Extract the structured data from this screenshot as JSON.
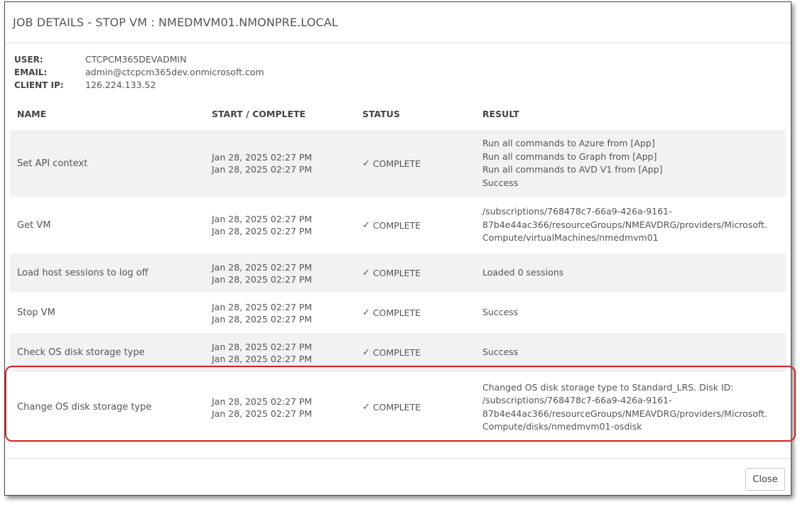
{
  "dialog": {
    "title": "JOB DETAILS - STOP VM : NMEDMVM01.NMONPRE.LOCAL"
  },
  "meta": {
    "user_label": "USER:",
    "user_value": "CTCPCM365DEVADMIN",
    "email_label": "EMAIL:",
    "email_value": "admin@ctcpcm365dev.onmicrosoft.com",
    "ip_label": "CLIENT IP:",
    "ip_value": "126.224.133.52"
  },
  "table": {
    "headers": {
      "name": "NAME",
      "time": "START / COMPLETE",
      "status": "STATUS",
      "result": "RESULT"
    },
    "rows": [
      {
        "name": "Set API context",
        "start": "Jan 28, 2025 02:27 PM",
        "complete": "Jan 28, 2025 02:27 PM",
        "status": "COMPLETE",
        "result": [
          "Run all commands to Azure from [App]",
          "Run all commands to Graph from [App]",
          "Run all commands to AVD V1 from [App]",
          "Success"
        ]
      },
      {
        "name": "Get VM",
        "start": "Jan 28, 2025 02:27 PM",
        "complete": "Jan 28, 2025 02:27 PM",
        "status": "COMPLETE",
        "result": [
          "/subscriptions/768478c7-66a9-426a-9161-",
          "87b4e44ac366/resourceGroups/NMEAVDRG/providers/Microsoft.",
          "Compute/virtualMachines/nmedmvm01"
        ]
      },
      {
        "name": "Load host sessions to log off",
        "start": "Jan 28, 2025 02:27 PM",
        "complete": "Jan 28, 2025 02:27 PM",
        "status": "COMPLETE",
        "result": [
          "Loaded 0 sessions"
        ]
      },
      {
        "name": "Stop VM",
        "start": "Jan 28, 2025 02:27 PM",
        "complete": "Jan 28, 2025 02:27 PM",
        "status": "COMPLETE",
        "result": [
          "Success"
        ]
      },
      {
        "name": "Check OS disk storage type",
        "start": "Jan 28, 2025 02:27 PM",
        "complete": "Jan 28, 2025 02:27 PM",
        "status": "COMPLETE",
        "result": [
          "Success"
        ]
      },
      {
        "name": "Change OS disk storage type",
        "start": "Jan 28, 2025 02:27 PM",
        "complete": "Jan 28, 2025 02:27 PM",
        "status": "COMPLETE",
        "result": [
          "Changed OS disk storage type to Standard_LRS. Disk ID:",
          "/subscriptions/768478c7-66a9-426a-9161-",
          "87b4e44ac366/resourceGroups/NMEAVDRG/providers/Microsoft.",
          "Compute/disks/nmedmvm01-osdisk"
        ]
      }
    ]
  },
  "footer": {
    "close_label": "Close"
  },
  "colors": {
    "highlight": "#d62020",
    "row_shade": "#f2f2f2",
    "text": "#555555"
  },
  "icons": {
    "status_icon": "check-icon"
  }
}
